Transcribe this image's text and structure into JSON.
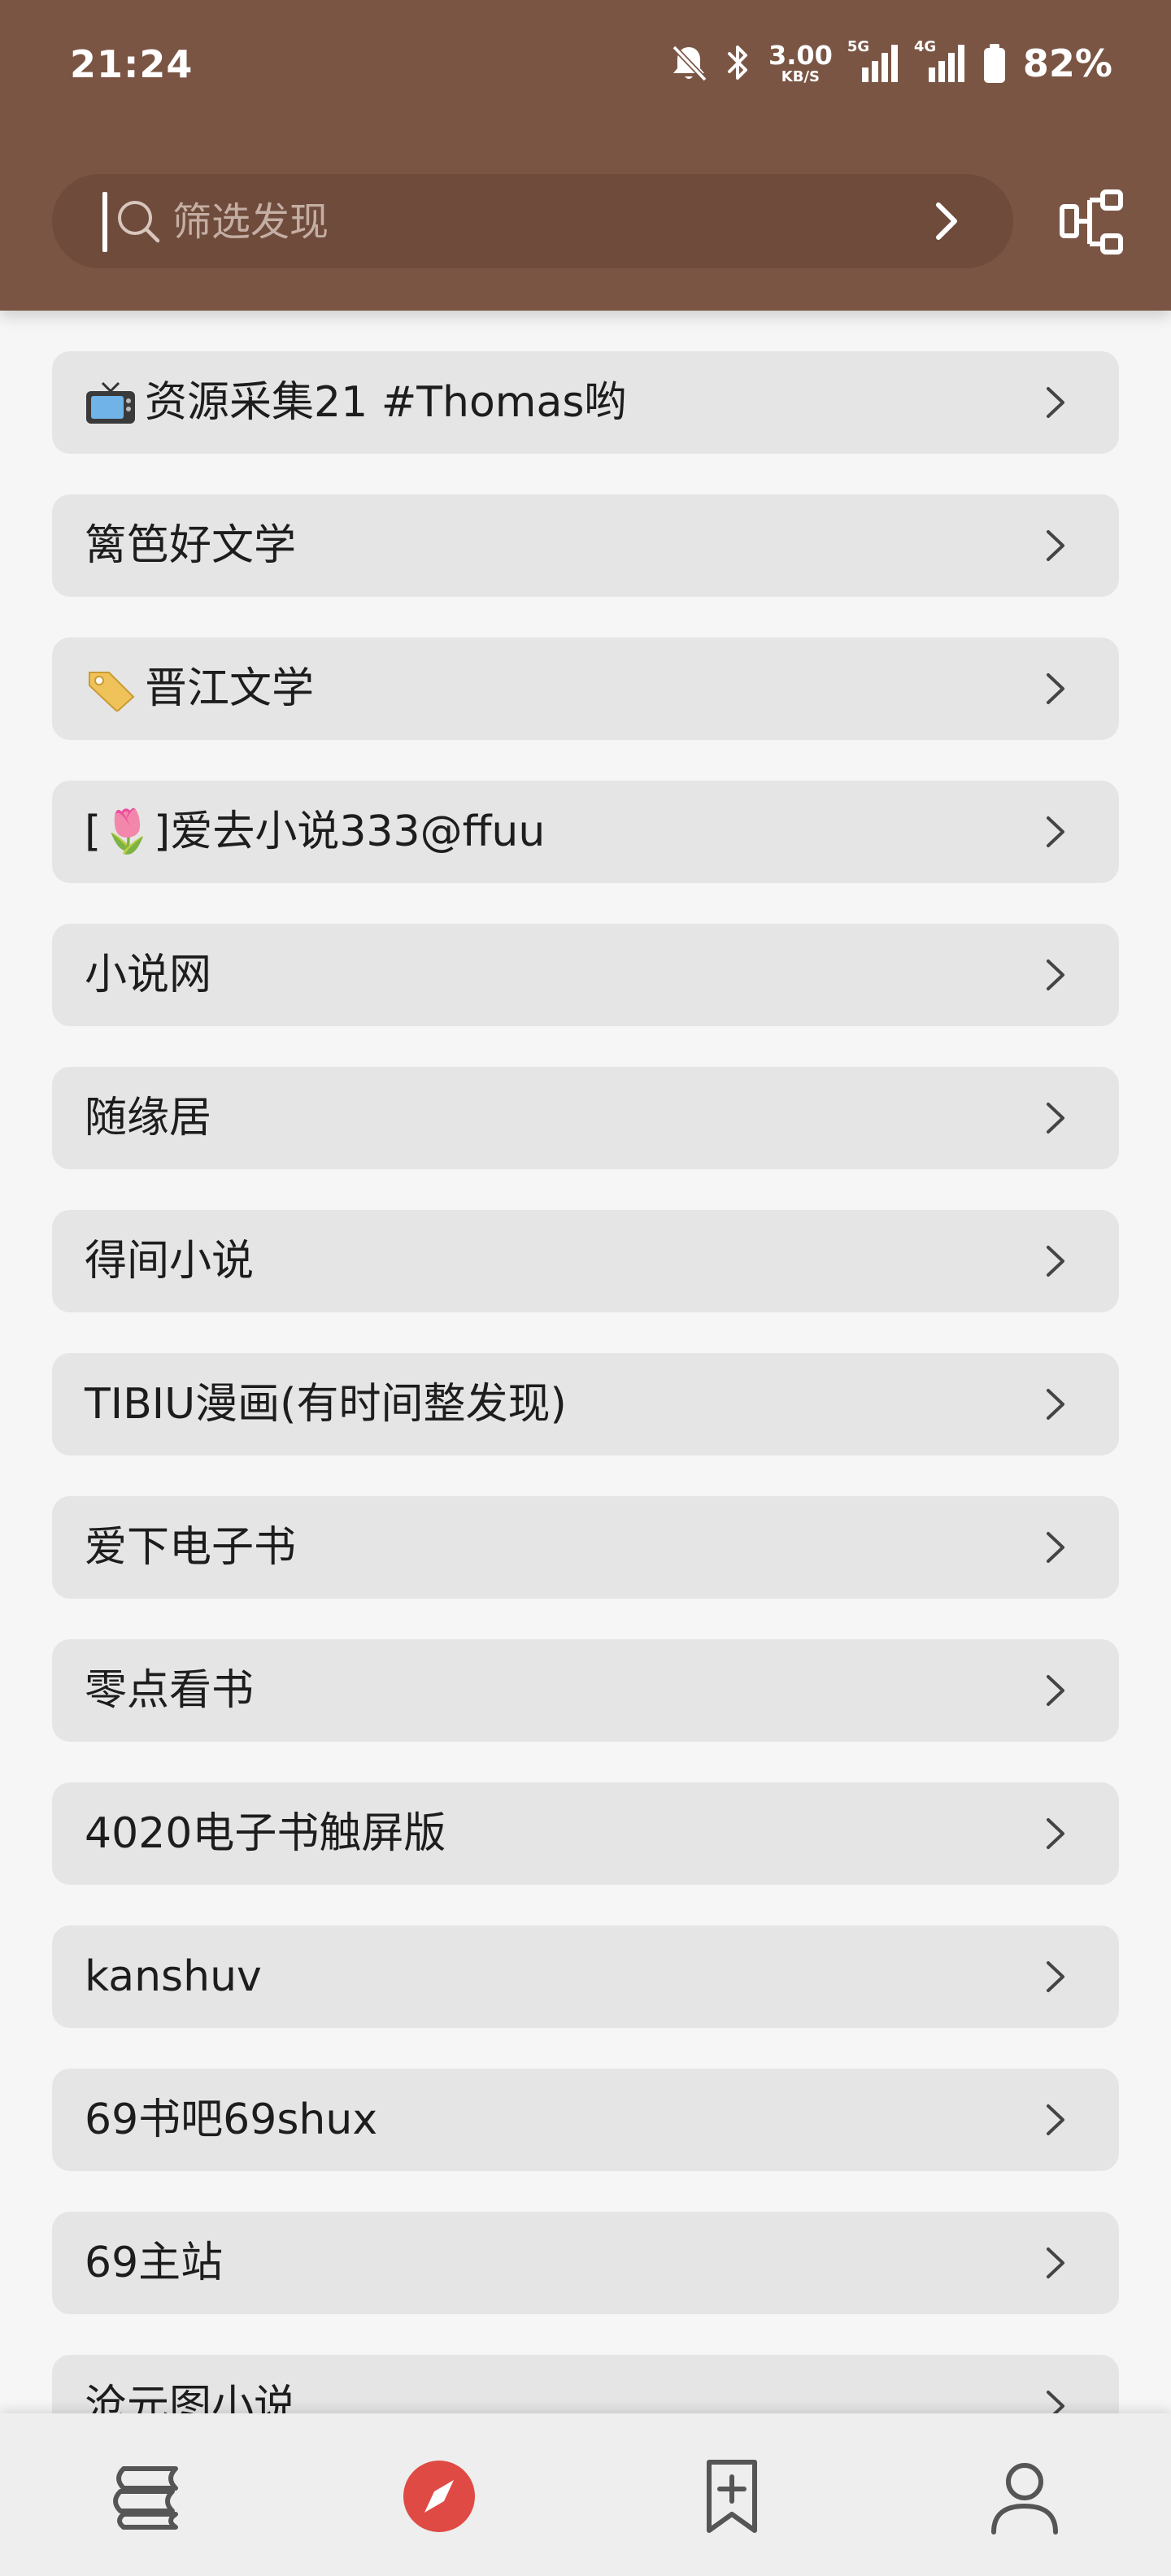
{
  "status_bar": {
    "time": "21:24",
    "net_speed_value": "3.00",
    "net_speed_unit": "KB/S",
    "sim1_tag": "5G",
    "sim2_tag": "4G",
    "battery_percent": "82%",
    "icons": [
      "mute-bell-icon",
      "bluetooth-icon",
      "signal-icon",
      "battery-icon"
    ]
  },
  "header": {
    "search_placeholder": "筛选发现",
    "search_value": "",
    "icons": [
      "search-icon",
      "chevron-right-icon",
      "tree-structure-icon"
    ],
    "colors": {
      "background": "#7b5544",
      "search_bg": "#6f4b3c"
    }
  },
  "sources": [
    {
      "emoji": "tv",
      "label": "资源采集21 #Thomas哟"
    },
    {
      "emoji": "",
      "label": "篱笆好文学"
    },
    {
      "emoji": "tag",
      "label": "晋江文学"
    },
    {
      "emoji": "",
      "label": "[🌷]爱去小说333@ffuu"
    },
    {
      "emoji": "",
      "label": "小说网"
    },
    {
      "emoji": "",
      "label": "随缘居"
    },
    {
      "emoji": "",
      "label": "得间小说"
    },
    {
      "emoji": "",
      "label": "TIBIU漫画(有时间整发现)"
    },
    {
      "emoji": "",
      "label": "爱下电子书"
    },
    {
      "emoji": "",
      "label": "零点看书"
    },
    {
      "emoji": "",
      "label": "4020电子书触屏版"
    },
    {
      "emoji": "",
      "label": "kanshuv"
    },
    {
      "emoji": "",
      "label": "69书吧69shux"
    },
    {
      "emoji": "",
      "label": "69主站"
    },
    {
      "emoji": "",
      "label": "沧元图小说"
    }
  ],
  "bottom_nav": {
    "items": [
      {
        "name": "bookshelf",
        "icon": "bookshelf-icon",
        "active": false
      },
      {
        "name": "discover",
        "icon": "compass-icon",
        "active": true
      },
      {
        "name": "subscriptions",
        "icon": "bookmark-add-icon",
        "active": false
      },
      {
        "name": "profile",
        "icon": "person-icon",
        "active": false
      }
    ],
    "colors": {
      "active": "#e04a45",
      "inactive": "#555555"
    }
  }
}
